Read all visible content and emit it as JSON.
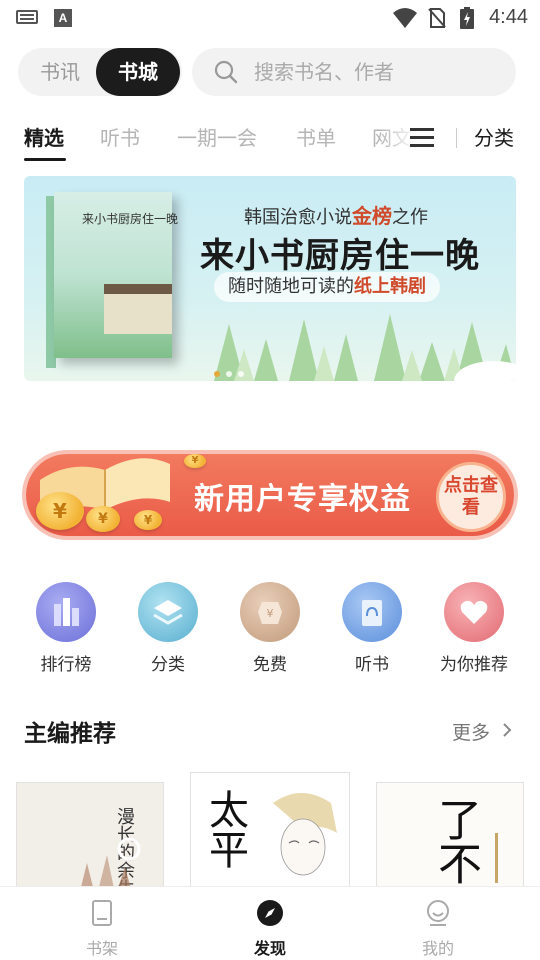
{
  "status_bar": {
    "time": "4:44",
    "icons": [
      "keyboard-icon",
      "text-a-icon",
      "wifi-icon",
      "no-sim-icon",
      "battery-charging-icon"
    ]
  },
  "header": {
    "segments": [
      "书讯",
      "书城"
    ],
    "active_segment": "书城",
    "search_placeholder": "搜索书名、作者"
  },
  "tabs": {
    "items": [
      "精选",
      "听书",
      "一期一会",
      "书单",
      "网文"
    ],
    "active": "精选",
    "category_label": "分类"
  },
  "banner": {
    "line1_prefix": "韩国治愈小说",
    "line1_highlight": "金榜",
    "line1_suffix": "之作",
    "title": "来小书厨房住一晚",
    "line3_prefix": "随时随地可读的",
    "line3_highlight": "纸上韩剧",
    "book_cover_title": "来小书厨房住一晚"
  },
  "promo": {
    "text": "新用户专享权益",
    "cta": "点击查看"
  },
  "quick_entries": [
    {
      "label": "排行榜",
      "icon": "ranking-icon",
      "color": "#7b7fe0"
    },
    {
      "label": "分类",
      "icon": "category-icon",
      "color": "#63b7d8"
    },
    {
      "label": "免费",
      "icon": "free-icon",
      "color": "#caa487"
    },
    {
      "label": "听书",
      "icon": "audiobook-icon",
      "color": "#6ea3e6"
    },
    {
      "label": "为你推荐",
      "icon": "heart-icon",
      "color": "#ea7f86"
    }
  ],
  "section": {
    "title": "主编推荐",
    "more": "更多"
  },
  "books": [
    {
      "cover_title": "漫长的余生"
    },
    {
      "cover_title": "太平"
    },
    {
      "cover_title": "了不"
    }
  ],
  "bottom_nav": [
    {
      "label": "书架",
      "icon": "bookshelf-icon"
    },
    {
      "label": "发现",
      "icon": "discover-compass-icon"
    },
    {
      "label": "我的",
      "icon": "profile-icon"
    }
  ],
  "active_nav": "发现"
}
